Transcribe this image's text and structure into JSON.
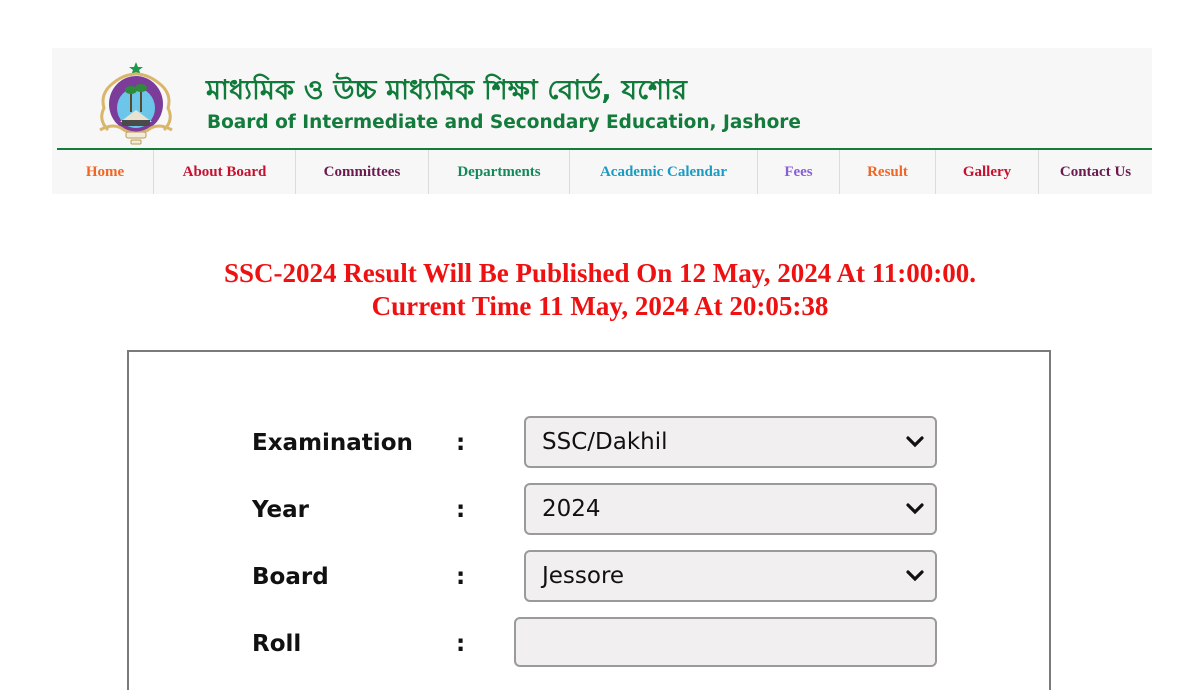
{
  "header": {
    "title_bn": "মাধ্যমিক ও উচ্চ মাধ্যমিক শিক্ষা বোর্ড, যশোর",
    "title_en": "Board of Intermediate and Secondary Education, Jashore",
    "logo_icon": "board-emblem-icon"
  },
  "nav": {
    "items": [
      {
        "label": "Home",
        "color": "#f26522"
      },
      {
        "label": "About Board",
        "color": "#c8102e"
      },
      {
        "label": "Committees",
        "color": "#6b1a4f"
      },
      {
        "label": "Departments",
        "color": "#138a5a"
      },
      {
        "label": "Academic Calendar",
        "color": "#1a9bc2"
      },
      {
        "label": "Fees",
        "color": "#8a5fd6"
      },
      {
        "label": "Result",
        "color": "#f26522"
      },
      {
        "label": "Gallery",
        "color": "#c8102e"
      },
      {
        "label": "Contact Us",
        "color": "#6b1a4f"
      }
    ]
  },
  "notice": {
    "line1": "SSC-2024 Result Will Be Published On 12 May, 2024 At 11:00:00.",
    "line2": "Current Time 11 May, 2024 At 20:05:38",
    "color": "#ee1111"
  },
  "form": {
    "separator": ":",
    "examination": {
      "label": "Examination",
      "value": "SSC/Dakhil"
    },
    "year": {
      "label": "Year",
      "value": "2024"
    },
    "board": {
      "label": "Board",
      "value": "Jessore"
    },
    "roll": {
      "label": "Roll",
      "value": ""
    }
  }
}
